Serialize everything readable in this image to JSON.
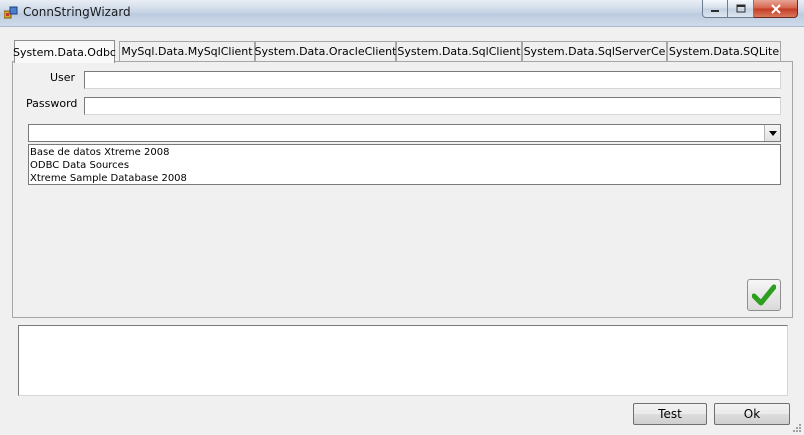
{
  "window": {
    "title": "ConnStringWizard",
    "icons": {
      "app": "database-icon",
      "minimize": "minimize-icon",
      "maximize": "maximize-icon",
      "close": "close-icon"
    }
  },
  "tabs": [
    {
      "label": "System.Data.Odbc",
      "active": true
    },
    {
      "label": "MySql.Data.MySqlClient",
      "active": false
    },
    {
      "label": "System.Data.OracleClient",
      "active": false
    },
    {
      "label": "System.Data.SqlClient",
      "active": false
    },
    {
      "label": "System.Data.SqlServerCe",
      "active": false
    },
    {
      "label": "System.Data.SQLite",
      "active": false
    }
  ],
  "form": {
    "user_label": "User",
    "user_value": "",
    "password_label": "Password",
    "password_value": "",
    "dsn_selected": "",
    "dsn_options": [
      "Base de datos Xtreme 2008",
      "ODBC Data Sources",
      "Xtreme Sample Database 2008"
    ],
    "dropdown_icon": "chevron-down-icon",
    "confirm_icon": "checkmark-icon",
    "confirm_color": "#2e9e1f"
  },
  "output": {
    "text": ""
  },
  "buttons": {
    "test": "Test",
    "ok": "Ok"
  }
}
